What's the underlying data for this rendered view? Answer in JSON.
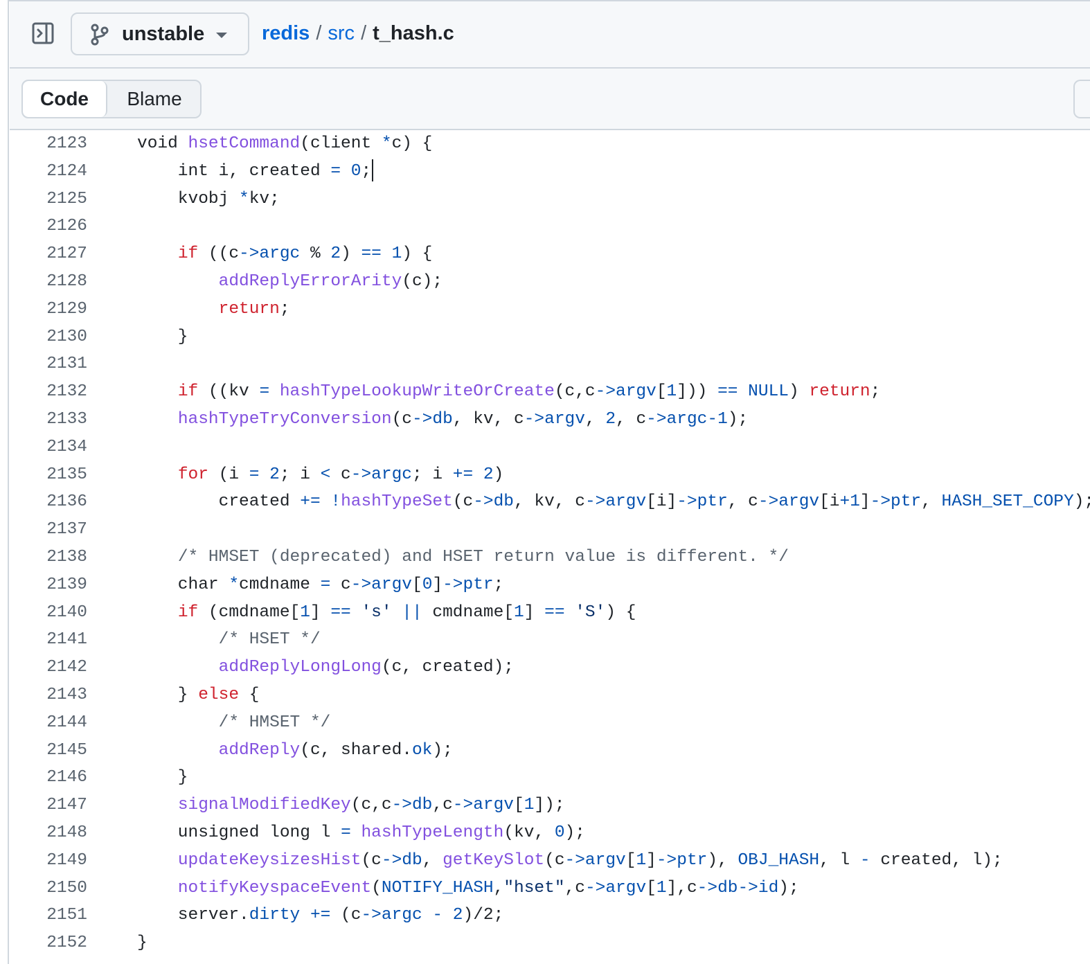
{
  "branch": {
    "name": "unstable"
  },
  "breadcrumb": {
    "repo": "redis",
    "sep1": "/",
    "dir": "src",
    "sep2": "/",
    "file": "t_hash.c"
  },
  "tabs": {
    "code": "Code",
    "blame": "Blame"
  },
  "lines": [
    {
      "n": "2123",
      "t": [
        [
          "",
          "void "
        ],
        [
          "f",
          "hsetCommand"
        ],
        [
          "",
          "(client "
        ],
        [
          "c",
          "*"
        ],
        [
          "",
          "c) {"
        ]
      ]
    },
    {
      "n": "2124",
      "t": [
        [
          "",
          "    int i, created "
        ],
        [
          "c",
          "="
        ],
        [
          "",
          " "
        ],
        [
          "c",
          "0"
        ],
        [
          "",
          ";"
        ]
      ]
    },
    {
      "n": "2125",
      "t": [
        [
          "",
          "    kvobj "
        ],
        [
          "c",
          "*"
        ],
        [
          "",
          "kv;"
        ]
      ]
    },
    {
      "n": "2126",
      "t": []
    },
    {
      "n": "2127",
      "t": [
        [
          "",
          "    "
        ],
        [
          "k",
          "if"
        ],
        [
          "",
          " ((c"
        ],
        [
          "c",
          "->argc"
        ],
        [
          "",
          " % "
        ],
        [
          "c",
          "2"
        ],
        [
          "",
          ") "
        ],
        [
          "c",
          "=="
        ],
        [
          "",
          " "
        ],
        [
          "c",
          "1"
        ],
        [
          "",
          ") {"
        ]
      ]
    },
    {
      "n": "2128",
      "t": [
        [
          "",
          "        "
        ],
        [
          "f",
          "addReplyErrorArity"
        ],
        [
          "",
          "(c);"
        ]
      ]
    },
    {
      "n": "2129",
      "t": [
        [
          "",
          "        "
        ],
        [
          "k",
          "return"
        ],
        [
          "",
          ";"
        ]
      ]
    },
    {
      "n": "2130",
      "t": [
        [
          "",
          "    }"
        ]
      ]
    },
    {
      "n": "2131",
      "t": []
    },
    {
      "n": "2132",
      "t": [
        [
          "",
          "    "
        ],
        [
          "k",
          "if"
        ],
        [
          "",
          " ((kv "
        ],
        [
          "c",
          "="
        ],
        [
          "",
          " "
        ],
        [
          "f",
          "hashTypeLookupWriteOrCreate"
        ],
        [
          "",
          "(c,c"
        ],
        [
          "c",
          "->argv"
        ],
        [
          "",
          "["
        ],
        [
          "c",
          "1"
        ],
        [
          "",
          "])) "
        ],
        [
          "c",
          "=="
        ],
        [
          "",
          " "
        ],
        [
          "c",
          "NULL"
        ],
        [
          "",
          ") "
        ],
        [
          "k",
          "return"
        ],
        [
          "",
          ";"
        ]
      ]
    },
    {
      "n": "2133",
      "t": [
        [
          "",
          "    "
        ],
        [
          "f",
          "hashTypeTryConversion"
        ],
        [
          "",
          "(c"
        ],
        [
          "c",
          "->db"
        ],
        [
          "",
          ", kv, c"
        ],
        [
          "c",
          "->argv"
        ],
        [
          "",
          ", "
        ],
        [
          "c",
          "2"
        ],
        [
          "",
          ", c"
        ],
        [
          "c",
          "->argc"
        ],
        [
          "c",
          "-"
        ],
        [
          "c",
          "1"
        ],
        [
          "",
          ");"
        ]
      ]
    },
    {
      "n": "2134",
      "t": []
    },
    {
      "n": "2135",
      "t": [
        [
          "",
          "    "
        ],
        [
          "k",
          "for"
        ],
        [
          "",
          " (i "
        ],
        [
          "c",
          "="
        ],
        [
          "",
          " "
        ],
        [
          "c",
          "2"
        ],
        [
          "",
          "; i "
        ],
        [
          "c",
          "<"
        ],
        [
          "",
          " c"
        ],
        [
          "c",
          "->argc"
        ],
        [
          "",
          "; i "
        ],
        [
          "c",
          "+="
        ],
        [
          "",
          " "
        ],
        [
          "c",
          "2"
        ],
        [
          "",
          ")"
        ]
      ]
    },
    {
      "n": "2136",
      "t": [
        [
          "",
          "        created "
        ],
        [
          "c",
          "+="
        ],
        [
          "",
          " "
        ],
        [
          "c",
          "!"
        ],
        [
          "f",
          "hashTypeSet"
        ],
        [
          "",
          "(c"
        ],
        [
          "c",
          "->db"
        ],
        [
          "",
          ", kv, c"
        ],
        [
          "c",
          "->argv"
        ],
        [
          "",
          "[i]"
        ],
        [
          "c",
          "->ptr"
        ],
        [
          "",
          ", c"
        ],
        [
          "c",
          "->argv"
        ],
        [
          "",
          "[i"
        ],
        [
          "c",
          "+"
        ],
        [
          "c",
          "1"
        ],
        [
          "",
          "]"
        ],
        [
          "c",
          "->ptr"
        ],
        [
          "",
          ", "
        ],
        [
          "c",
          "HASH_SET_COPY"
        ],
        [
          "",
          ");"
        ]
      ]
    },
    {
      "n": "2137",
      "t": []
    },
    {
      "n": "2138",
      "t": [
        [
          "",
          "    "
        ],
        [
          "m",
          "/* HMSET (deprecated) and HSET return value is different. */"
        ]
      ]
    },
    {
      "n": "2139",
      "t": [
        [
          "",
          "    char "
        ],
        [
          "c",
          "*"
        ],
        [
          "",
          "cmdname "
        ],
        [
          "c",
          "="
        ],
        [
          "",
          " c"
        ],
        [
          "c",
          "->argv"
        ],
        [
          "",
          "["
        ],
        [
          "c",
          "0"
        ],
        [
          "",
          "]"
        ],
        [
          "c",
          "->ptr"
        ],
        [
          "",
          ";"
        ]
      ]
    },
    {
      "n": "2140",
      "t": [
        [
          "",
          "    "
        ],
        [
          "k",
          "if"
        ],
        [
          "",
          " (cmdname["
        ],
        [
          "c",
          "1"
        ],
        [
          "",
          "] "
        ],
        [
          "c",
          "=="
        ],
        [
          "",
          " "
        ],
        [
          "s",
          "'s'"
        ],
        [
          "",
          " "
        ],
        [
          "c",
          "||"
        ],
        [
          "",
          " cmdname["
        ],
        [
          "c",
          "1"
        ],
        [
          "",
          "] "
        ],
        [
          "c",
          "=="
        ],
        [
          "",
          " "
        ],
        [
          "s",
          "'S'"
        ],
        [
          "",
          ") {"
        ]
      ]
    },
    {
      "n": "2141",
      "t": [
        [
          "",
          "        "
        ],
        [
          "m",
          "/* HSET */"
        ]
      ]
    },
    {
      "n": "2142",
      "t": [
        [
          "",
          "        "
        ],
        [
          "f",
          "addReplyLongLong"
        ],
        [
          "",
          "(c, created);"
        ]
      ]
    },
    {
      "n": "2143",
      "t": [
        [
          "",
          "    } "
        ],
        [
          "k",
          "else"
        ],
        [
          "",
          " {"
        ]
      ]
    },
    {
      "n": "2144",
      "t": [
        [
          "",
          "        "
        ],
        [
          "m",
          "/* HMSET */"
        ]
      ]
    },
    {
      "n": "2145",
      "t": [
        [
          "",
          "        "
        ],
        [
          "f",
          "addReply"
        ],
        [
          "",
          "(c, shared."
        ],
        [
          "c",
          "ok"
        ],
        [
          "",
          ");"
        ]
      ]
    },
    {
      "n": "2146",
      "t": [
        [
          "",
          "    }"
        ]
      ]
    },
    {
      "n": "2147",
      "t": [
        [
          "",
          "    "
        ],
        [
          "f",
          "signalModifiedKey"
        ],
        [
          "",
          "(c,c"
        ],
        [
          "c",
          "->db"
        ],
        [
          "",
          ",c"
        ],
        [
          "c",
          "->argv"
        ],
        [
          "",
          "["
        ],
        [
          "c",
          "1"
        ],
        [
          "",
          "]);"
        ]
      ]
    },
    {
      "n": "2148",
      "t": [
        [
          "",
          "    unsigned long l "
        ],
        [
          "c",
          "="
        ],
        [
          "",
          " "
        ],
        [
          "f",
          "hashTypeLength"
        ],
        [
          "",
          "(kv, "
        ],
        [
          "c",
          "0"
        ],
        [
          "",
          ");"
        ]
      ]
    },
    {
      "n": "2149",
      "t": [
        [
          "",
          "    "
        ],
        [
          "f",
          "updateKeysizesHist"
        ],
        [
          "",
          "(c"
        ],
        [
          "c",
          "->db"
        ],
        [
          "",
          ", "
        ],
        [
          "f",
          "getKeySlot"
        ],
        [
          "",
          "(c"
        ],
        [
          "c",
          "->argv"
        ],
        [
          "",
          "["
        ],
        [
          "c",
          "1"
        ],
        [
          "",
          "]"
        ],
        [
          "c",
          "->ptr"
        ],
        [
          "",
          "), "
        ],
        [
          "c",
          "OBJ_HASH"
        ],
        [
          "",
          ", l "
        ],
        [
          "c",
          "-"
        ],
        [
          "",
          " created, l);"
        ]
      ]
    },
    {
      "n": "2150",
      "t": [
        [
          "",
          "    "
        ],
        [
          "f",
          "notifyKeyspaceEvent"
        ],
        [
          "",
          "("
        ],
        [
          "c",
          "NOTIFY_HASH"
        ],
        [
          "",
          ","
        ],
        [
          "s",
          "\"hset\""
        ],
        [
          "",
          ",c"
        ],
        [
          "c",
          "->argv"
        ],
        [
          "",
          "["
        ],
        [
          "c",
          "1"
        ],
        [
          "",
          "],c"
        ],
        [
          "c",
          "->db->id"
        ],
        [
          "",
          ");"
        ]
      ]
    },
    {
      "n": "2151",
      "t": [
        [
          "",
          "    server."
        ],
        [
          "c",
          "dirty"
        ],
        [
          "",
          " "
        ],
        [
          "c",
          "+="
        ],
        [
          "",
          " (c"
        ],
        [
          "c",
          "->argc"
        ],
        [
          "",
          " "
        ],
        [
          "c",
          "-"
        ],
        [
          "",
          " "
        ],
        [
          "c",
          "2"
        ],
        [
          "",
          ")/2;"
        ]
      ]
    },
    {
      "n": "2152",
      "t": [
        [
          "",
          "}"
        ]
      ]
    }
  ],
  "cursor": {
    "line": "2124"
  },
  "icons": {
    "panel": "sidebar-expand-icon",
    "branch": "git-branch-icon",
    "dropdown": "triangle-down-icon"
  }
}
